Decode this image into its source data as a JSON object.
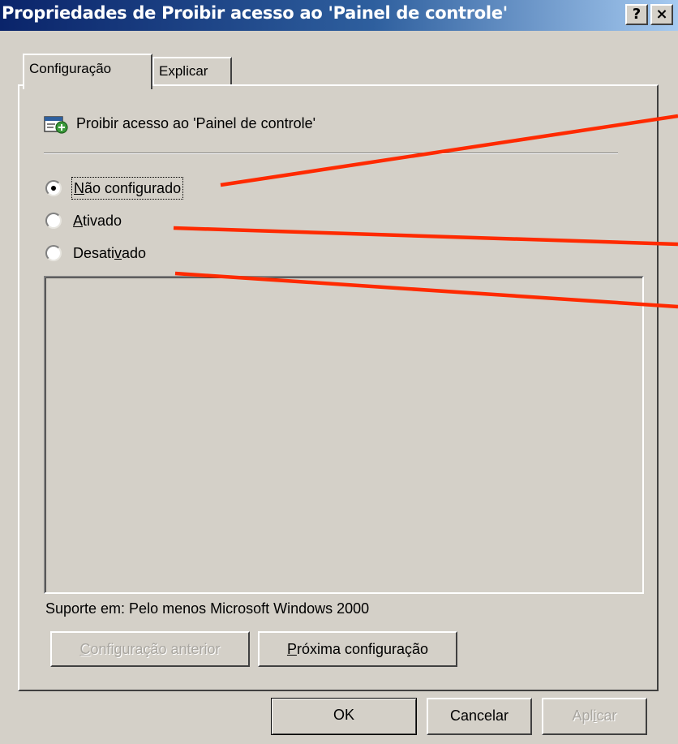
{
  "window": {
    "title": "Propriedades de Proibir acesso ao 'Painel de controle'",
    "help_button": "?",
    "close_button": "×"
  },
  "tabs": [
    {
      "label": "Configuração",
      "selected": true
    },
    {
      "label": "Explicar",
      "selected": false
    }
  ],
  "policy": {
    "name": "Proibir acesso ao 'Painel de controle'",
    "icon": "policy-settings-icon"
  },
  "options": [
    {
      "label_before": "",
      "label_mnemonic": "N",
      "label_after": "ão configurado",
      "selected": true
    },
    {
      "label_before": "",
      "label_mnemonic": "A",
      "label_after": "tivado",
      "selected": false
    },
    {
      "label_before": "Desati",
      "label_mnemonic": "v",
      "label_after": "ado",
      "selected": false
    }
  ],
  "support": {
    "text": "Suporte em:  Pelo menos Microsoft Windows 2000"
  },
  "buttons": {
    "previous_before": "",
    "previous_mnemonic": "C",
    "previous_after": "onfiguração anterior",
    "next_before": "",
    "next_mnemonic": "P",
    "next_after": "róxima configuração",
    "ok": "OK",
    "cancel": "Cancelar",
    "apply_before": "Apl",
    "apply_mnemonic": "i",
    "apply_after": "car"
  },
  "colors": {
    "annotation_line": "#ff2a00",
    "titlebar_start": "#0a246a",
    "dialog_face": "#d4d0c8"
  }
}
